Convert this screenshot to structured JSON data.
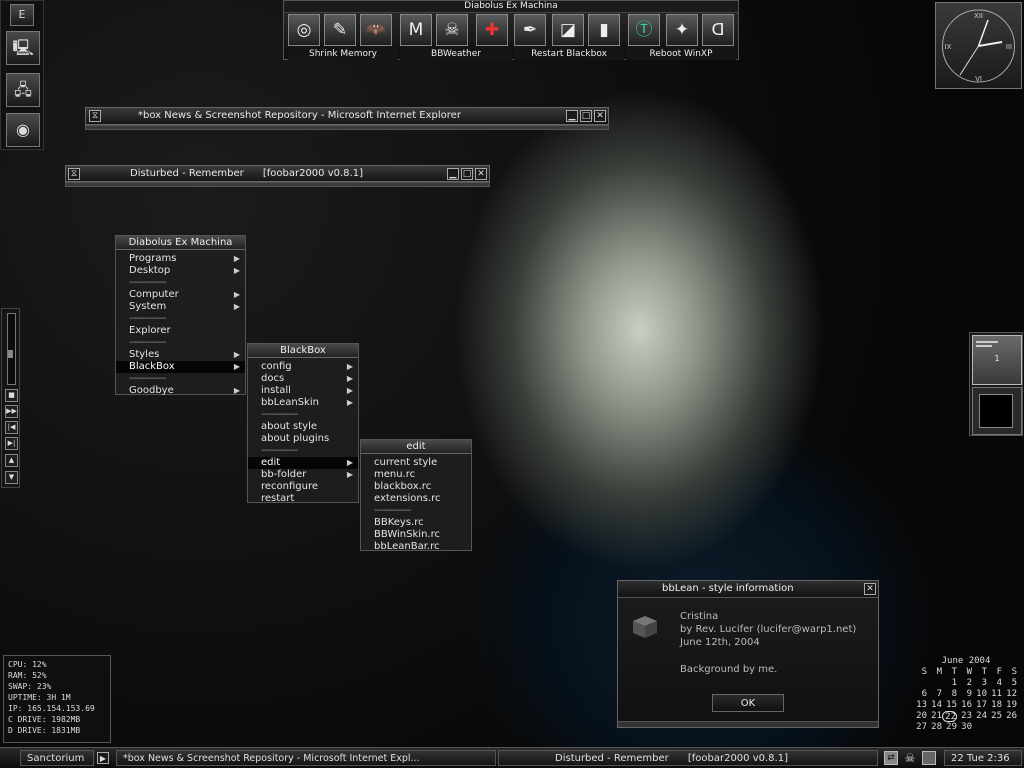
{
  "left_launcher": {
    "items": [
      {
        "name": "e-button",
        "glyph": "E"
      },
      {
        "name": "computer-icon",
        "glyph": "🖳"
      },
      {
        "name": "network-icon",
        "glyph": "🖧"
      },
      {
        "name": "blackbox-icon",
        "glyph": "◉"
      }
    ]
  },
  "toolbar": {
    "title": "Diabolus Ex Machina",
    "labels": [
      "Shrink Memory",
      "BBWeather",
      "Restart Blackbox",
      "Reboot WinXP"
    ],
    "icons": [
      "◎",
      "✎",
      "🦇",
      "M",
      "☠",
      "✚",
      "✒",
      "◪",
      "▮",
      "Ⓣ",
      "✦",
      "ᗡ"
    ]
  },
  "clock": {
    "numerals": [
      "XII",
      "III",
      "VI",
      "IX"
    ]
  },
  "ie_window": {
    "title": "*box News & Screenshot Repository - Microsoft Internet Explorer"
  },
  "foobar_window": {
    "title": "Disturbed - Remember      [foobar2000 v0.8.1]"
  },
  "root_menu": {
    "title": "Diabolus Ex Machina",
    "items": [
      {
        "label": "Programs",
        "submenu": true
      },
      {
        "label": "Desktop",
        "submenu": true
      },
      {
        "separator": true
      },
      {
        "label": "Computer",
        "submenu": true
      },
      {
        "label": "System",
        "submenu": true
      },
      {
        "separator": true
      },
      {
        "label": "Explorer",
        "submenu": false
      },
      {
        "separator": true
      },
      {
        "label": "Styles",
        "submenu": true
      },
      {
        "label": "BlackBox",
        "submenu": true,
        "selected": true
      },
      {
        "separator": true
      },
      {
        "label": "Goodbye",
        "submenu": true
      }
    ]
  },
  "blackbox_menu": {
    "title": "BlackBox",
    "items": [
      {
        "label": "config",
        "submenu": true
      },
      {
        "label": "docs",
        "submenu": true
      },
      {
        "label": "install",
        "submenu": true
      },
      {
        "label": "bbLeanSkin",
        "submenu": true
      },
      {
        "separator": true
      },
      {
        "label": "about style",
        "submenu": false
      },
      {
        "label": "about plugins",
        "submenu": false
      },
      {
        "separator": true
      },
      {
        "label": "edit",
        "submenu": true,
        "selected": true
      },
      {
        "label": "bb-folder",
        "submenu": true
      },
      {
        "label": "reconfigure",
        "submenu": false
      },
      {
        "label": "restart",
        "submenu": false
      }
    ]
  },
  "edit_menu": {
    "title": "edit",
    "items": [
      {
        "label": "current style"
      },
      {
        "label": "menu.rc"
      },
      {
        "label": "blackbox.rc"
      },
      {
        "label": "extensions.rc"
      },
      {
        "separator": true
      },
      {
        "label": "BBKeys.rc"
      },
      {
        "label": "BBWinSkin.rc"
      },
      {
        "label": "bbLeanBar.rc"
      }
    ]
  },
  "separator_text": "--------------",
  "side_strip": {
    "buttons": [
      "■",
      "▶▶",
      "|◀",
      "▶|",
      "▲",
      "▼"
    ]
  },
  "workspace_pager": {
    "desk1_label": "1"
  },
  "style_dialog": {
    "title": "bbLean - style information",
    "style_name": "Cristina",
    "author": "by Rev. Lucifer (lucifer@warp1.net)",
    "date": "June 12th, 2004",
    "note": "Background by me.",
    "ok_label": "OK"
  },
  "sysinfo": {
    "lines": [
      "CPU: 12%",
      "RAM: 52%",
      "SWAP: 23%",
      "UPTIME: 3H 1M",
      "IP: 165.154.153.69",
      "C DRIVE: 1982MB",
      "D DRIVE: 1831MB"
    ]
  },
  "calendar": {
    "title": "June 2004",
    "weekdays": [
      "S",
      "M",
      "T",
      "W",
      "T",
      "F",
      "S"
    ],
    "weeks": [
      [
        "",
        "",
        "1",
        "2",
        "3",
        "4",
        "5"
      ],
      [
        "6",
        "7",
        "8",
        "9",
        "10",
        "11",
        "12"
      ],
      [
        "13",
        "14",
        "15",
        "16",
        "17",
        "18",
        "19"
      ],
      [
        "20",
        "21",
        "22",
        "23",
        "24",
        "25",
        "26"
      ],
      [
        "27",
        "28",
        "29",
        "30",
        "",
        "",
        ""
      ]
    ],
    "today": "22"
  },
  "taskbar": {
    "workspace": "Sanctorium",
    "tasks": [
      "*box News & Screenshot Repository - Microsoft Internet Expl...",
      "Disturbed - Remember      [foobar2000 v0.8.1]"
    ],
    "clock": "22 Tue 2:36"
  }
}
